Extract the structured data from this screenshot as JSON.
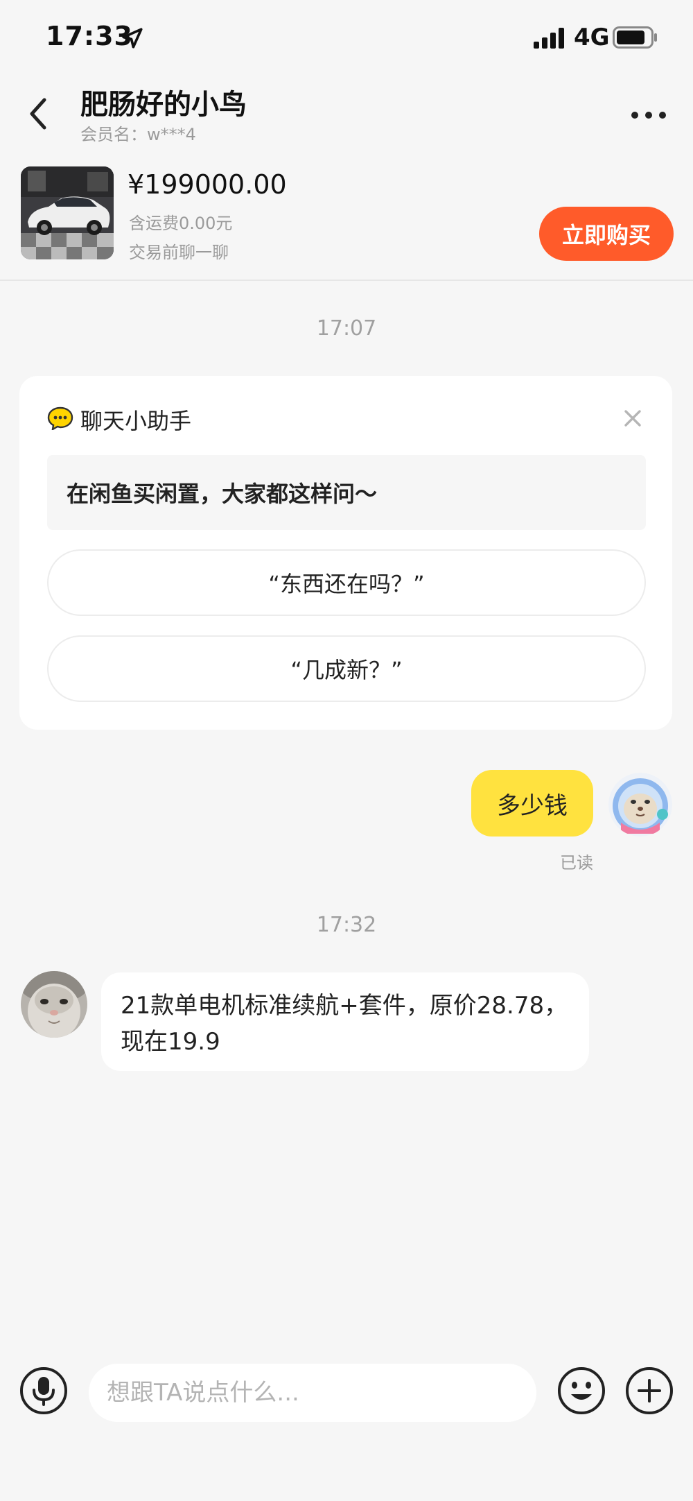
{
  "status_bar": {
    "time": "17:33",
    "network": "4G"
  },
  "header": {
    "title": "肥肠好的小鸟",
    "subtitle": "会员名：w***4"
  },
  "product": {
    "price": "¥199000.00",
    "shipping": "含运费0.00元",
    "prechat": "交易前聊一聊",
    "buy_label": "立即购买"
  },
  "timestamps": [
    "17:07",
    "17:32"
  ],
  "assistant": {
    "title": "聊天小助手",
    "hint": "在闲鱼买闲置，大家都这样问～",
    "suggestions": [
      "“东西还在吗？”",
      "“几成新？”"
    ]
  },
  "messages": {
    "outgoing": "多少钱",
    "read_status": "已读",
    "incoming": "21款单电机标准续航+套件，原价28.78，现在19.9"
  },
  "input_bar": {
    "placeholder": "想跟TA说点什么..."
  },
  "colors": {
    "accent_yellow": "#ffe23f",
    "buy_orange": "#ff5b2a",
    "background": "#f6f6f6"
  },
  "icons": [
    "location-arrow-icon",
    "signal-icon",
    "battery-icon",
    "back-icon",
    "more-icon",
    "chat-bubble-icon",
    "close-icon",
    "microphone-icon",
    "emoji-icon",
    "plus-icon"
  ]
}
